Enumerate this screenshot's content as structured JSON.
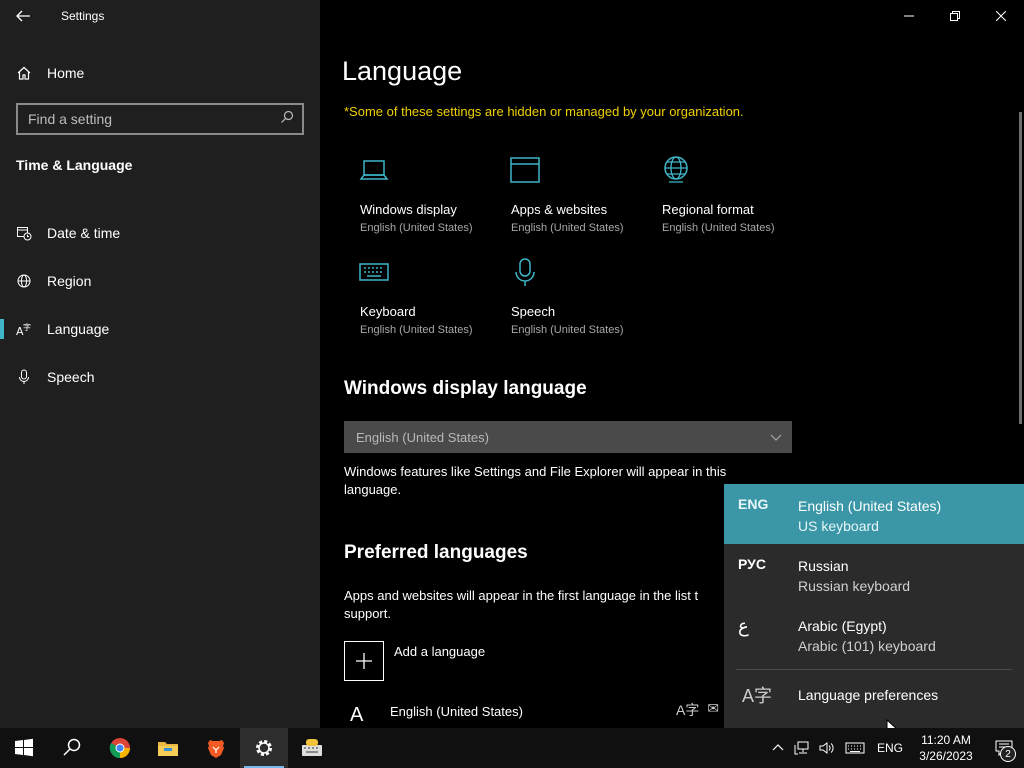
{
  "window": {
    "title": "Settings"
  },
  "sidebar": {
    "home_label": "Home",
    "search_placeholder": "Find a setting",
    "section_title": "Time & Language",
    "items": [
      {
        "label": "Date & time",
        "icon": "calendar-clock-icon"
      },
      {
        "label": "Region",
        "icon": "globe-icon"
      },
      {
        "label": "Language",
        "icon": "language-icon",
        "active": true
      },
      {
        "label": "Speech",
        "icon": "microphone-icon"
      }
    ]
  },
  "main": {
    "title": "Language",
    "org_note": "*Some of these settings are hidden or managed by your organization.",
    "tiles": [
      {
        "title": "Windows display",
        "sub": "English (United States)",
        "icon": "laptop-icon"
      },
      {
        "title": "Apps & websites",
        "sub": "English (United States)",
        "icon": "window-icon"
      },
      {
        "title": "Regional format",
        "sub": "English (United States)",
        "icon": "globe-icon"
      },
      {
        "title": "Keyboard",
        "sub": "English (United States)",
        "icon": "keyboard-icon"
      },
      {
        "title": "Speech",
        "sub": "English (United States)",
        "icon": "microphone-icon"
      }
    ],
    "display_language": {
      "heading": "Windows display language",
      "selected": "English (United States)",
      "desc_line1": "Windows features like Settings and File Explorer will appear in this",
      "desc_line2": "language."
    },
    "preferred": {
      "heading": "Preferred languages",
      "desc_line1": "Apps and websites will appear in the first language in the list t",
      "desc_line2": "support.",
      "add_label": "Add a language",
      "first_language": "English (United States)"
    }
  },
  "flyout": {
    "items": [
      {
        "abbr": "ENG",
        "language": "English (United States)",
        "keyboard": "US keyboard",
        "selected": true
      },
      {
        "abbr": "РУС",
        "language": "Russian",
        "keyboard": "Russian keyboard",
        "selected": false
      },
      {
        "abbr": "ع",
        "language": "Arabic (Egypt)",
        "keyboard": "Arabic (101) keyboard",
        "selected": false
      }
    ],
    "preferences_label": "Language preferences"
  },
  "taskbar": {
    "input_indicator": "ENG",
    "time": "11:20 AM",
    "date": "3/26/2023",
    "notification_count": "2",
    "colors": {
      "accent": "#3b97a7",
      "highlight": "#3fb6c8",
      "warning": "#f0d000"
    }
  }
}
